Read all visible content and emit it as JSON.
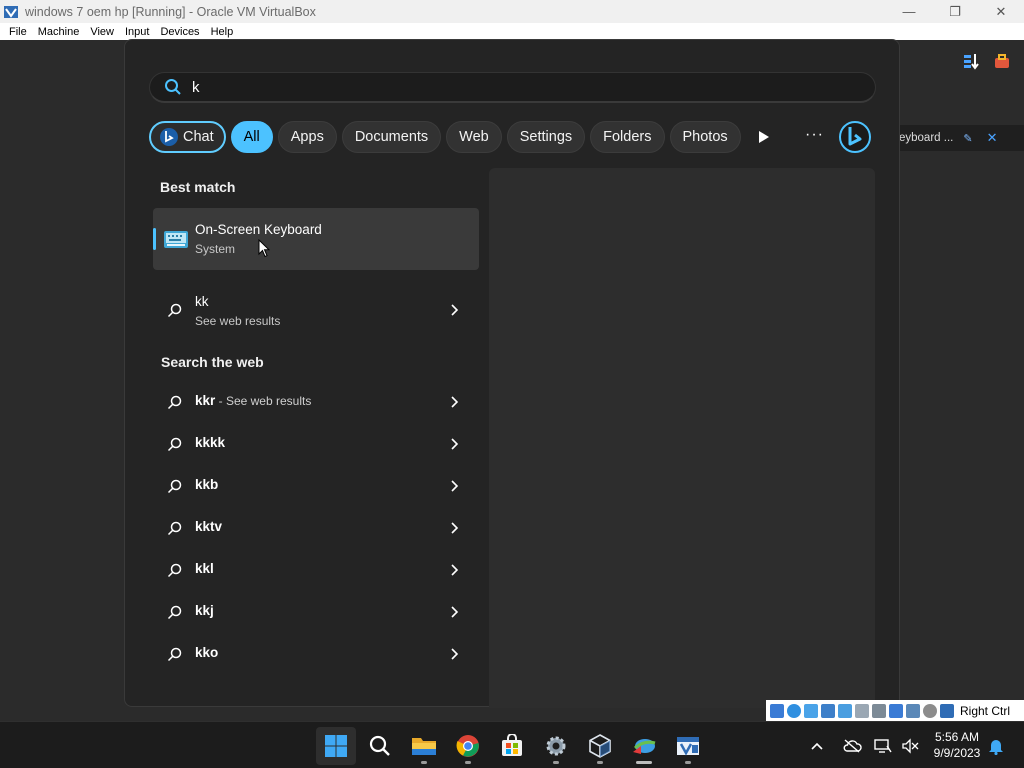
{
  "window": {
    "title": "windows 7 oem hp [Running] - Oracle VM VirtualBox",
    "controls": {
      "minimize": "—",
      "maximize": "❐",
      "close": "✕"
    }
  },
  "menubar": [
    "File",
    "Machine",
    "View",
    "Input",
    "Devices",
    "Help"
  ],
  "background_app": {
    "tab_label": "eyboard ..."
  },
  "search": {
    "query": "k"
  },
  "filters": {
    "chat": "Chat",
    "items": [
      "All",
      "Apps",
      "Documents",
      "Web",
      "Settings",
      "Folders",
      "Photos"
    ],
    "active": "All"
  },
  "best_match": {
    "heading": "Best match",
    "title": "On-Screen Keyboard",
    "subtitle": "System"
  },
  "web_suggestion": {
    "query": "kk",
    "subtitle": "See web results"
  },
  "search_the_web": {
    "heading": "Search the web",
    "first": {
      "query": "kkr",
      "suffix": " - See web results"
    },
    "items": [
      "kkkk",
      "kkb",
      "kktv",
      "kkl",
      "kkj",
      "kko"
    ]
  },
  "vbox_status": {
    "host_key": "Right Ctrl"
  },
  "taskbar": {
    "apps": [
      "start",
      "search",
      "file-explorer",
      "chrome",
      "microsoft-store",
      "settings",
      "virtualbox",
      "internet-download-manager",
      "windows-7-vm"
    ]
  },
  "tray": {
    "time": "5:56 AM",
    "date": "9/9/2023"
  },
  "colors": {
    "accent": "#4cc2ff",
    "panel": "#242424",
    "taskbar": "#1c1c1c"
  }
}
